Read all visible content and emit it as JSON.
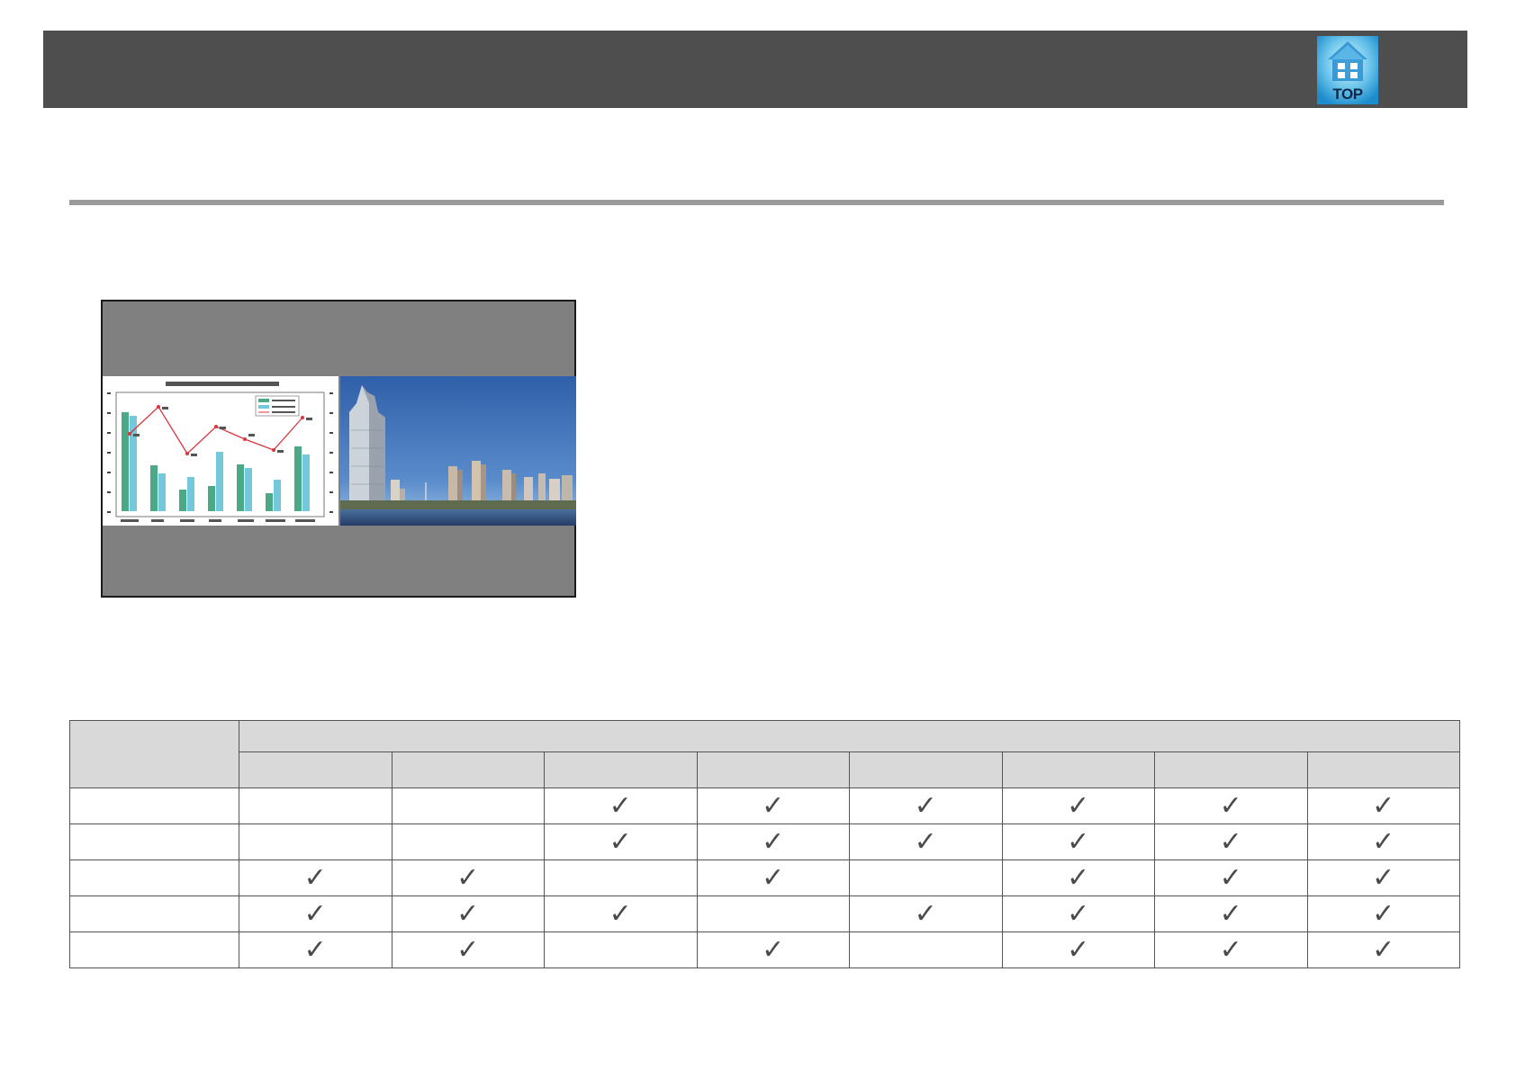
{
  "header": {
    "top_button_label": "TOP",
    "top_button_icon": "house-icon",
    "bar_color": "#4e4e4e"
  },
  "illustration": {
    "chart_icon": "bar-line-chart-thumbnail",
    "photo_icon": "city-skyline-photo",
    "frame_color": "#808080"
  },
  "support_table": {
    "check_glyph": "✓",
    "rows": [
      {
        "cells": [
          false,
          false,
          true,
          true,
          true,
          true,
          true,
          true
        ]
      },
      {
        "cells": [
          false,
          false,
          true,
          true,
          true,
          true,
          true,
          true
        ]
      },
      {
        "cells": [
          true,
          true,
          false,
          true,
          false,
          true,
          true,
          true
        ]
      },
      {
        "cells": [
          true,
          true,
          true,
          false,
          true,
          true,
          true,
          true
        ]
      },
      {
        "cells": [
          true,
          true,
          false,
          true,
          false,
          true,
          true,
          true
        ]
      }
    ]
  }
}
